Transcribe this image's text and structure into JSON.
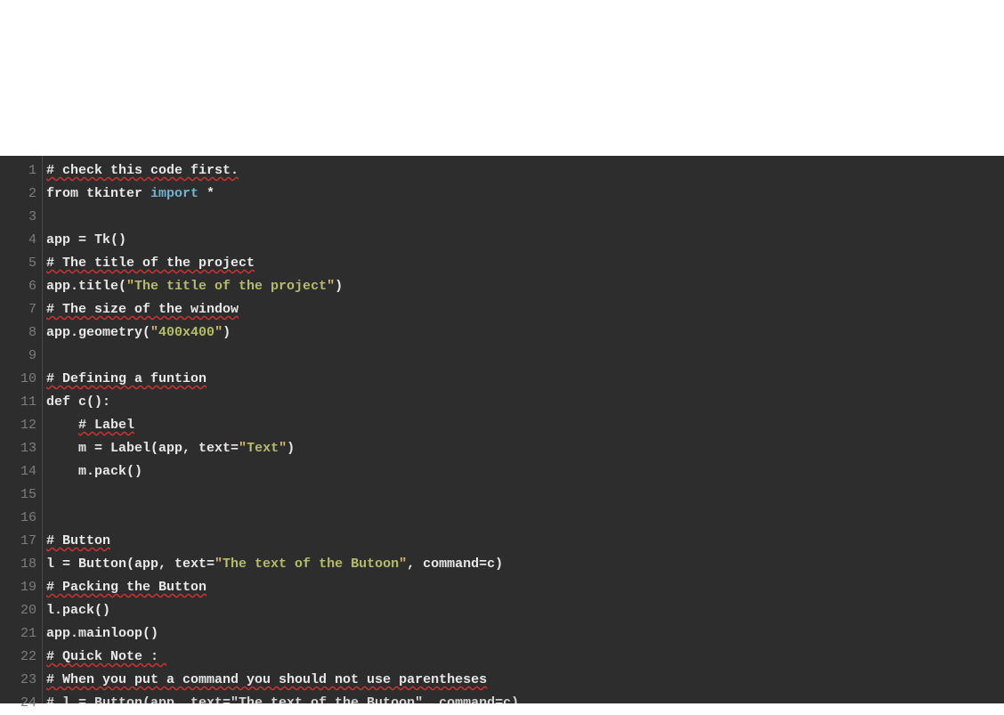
{
  "editor": {
    "first_visible_line": 1,
    "lines": [
      {
        "n": 1,
        "tokens": [
          {
            "t": "comment",
            "spell": true,
            "v": "# check this code first."
          }
        ]
      },
      {
        "n": 2,
        "tokens": [
          {
            "t": "default",
            "v": "from tkinter "
          },
          {
            "t": "kw",
            "v": "import"
          },
          {
            "t": "default",
            "v": " *"
          }
        ]
      },
      {
        "n": 3,
        "tokens": []
      },
      {
        "n": 4,
        "tokens": [
          {
            "t": "default",
            "v": "app = Tk()"
          }
        ]
      },
      {
        "n": 5,
        "tokens": [
          {
            "t": "comment",
            "spell": true,
            "v": "# The title of the project"
          }
        ]
      },
      {
        "n": 6,
        "tokens": [
          {
            "t": "default",
            "v": "app.title("
          },
          {
            "t": "str",
            "v": "The title of the project"
          },
          {
            "t": "default",
            "v": ")"
          }
        ]
      },
      {
        "n": 7,
        "tokens": [
          {
            "t": "comment",
            "spell": true,
            "v": "# The size of the window"
          }
        ]
      },
      {
        "n": 8,
        "tokens": [
          {
            "t": "default",
            "v": "app.geometry("
          },
          {
            "t": "str",
            "v": "400x400"
          },
          {
            "t": "default",
            "v": ")"
          }
        ]
      },
      {
        "n": 9,
        "tokens": []
      },
      {
        "n": 10,
        "tokens": [
          {
            "t": "comment",
            "spell": true,
            "v": "# Defining a funtion"
          }
        ]
      },
      {
        "n": 11,
        "tokens": [
          {
            "t": "default",
            "v": "def c():"
          }
        ]
      },
      {
        "n": 12,
        "tokens": [
          {
            "t": "default",
            "v": "    "
          },
          {
            "t": "comment",
            "spell": true,
            "v": "# Label"
          }
        ]
      },
      {
        "n": 13,
        "tokens": [
          {
            "t": "default",
            "v": "    m = Label(app, text="
          },
          {
            "t": "str",
            "v": "Text"
          },
          {
            "t": "default",
            "v": ")"
          }
        ]
      },
      {
        "n": 14,
        "tokens": [
          {
            "t": "default",
            "v": "    m.pack()"
          }
        ]
      },
      {
        "n": 15,
        "tokens": []
      },
      {
        "n": 16,
        "tokens": []
      },
      {
        "n": 17,
        "tokens": [
          {
            "t": "comment",
            "spell": true,
            "v": "# Button"
          }
        ]
      },
      {
        "n": 18,
        "tokens": [
          {
            "t": "default",
            "v": "l = Button(app, text="
          },
          {
            "t": "str",
            "v": "The text of the Butoon"
          },
          {
            "t": "default",
            "v": ", command=c)"
          }
        ]
      },
      {
        "n": 19,
        "tokens": [
          {
            "t": "comment",
            "spell": true,
            "v": "# Packing the Button"
          }
        ]
      },
      {
        "n": 20,
        "tokens": [
          {
            "t": "default",
            "v": "l.pack()"
          }
        ]
      },
      {
        "n": 21,
        "tokens": [
          {
            "t": "default",
            "v": "app.mainloop()"
          }
        ]
      },
      {
        "n": 22,
        "tokens": [
          {
            "t": "comment",
            "spell": true,
            "v": "# Quick Note : "
          }
        ]
      },
      {
        "n": 23,
        "tokens": [
          {
            "t": "comment",
            "spell": true,
            "v": "# When you put a command you should not use parentheses"
          }
        ]
      },
      {
        "n": 24,
        "partial": true,
        "tokens": [
          {
            "t": "comment",
            "v": "# l = Button(app, text=\"The text of the Butoon\", command=c)"
          }
        ]
      }
    ]
  }
}
